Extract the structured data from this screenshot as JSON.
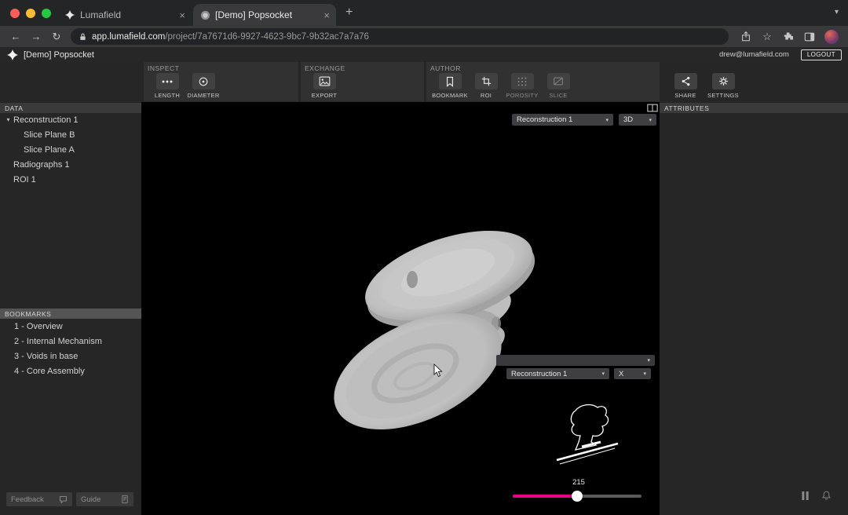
{
  "browser": {
    "tabs": [
      {
        "label": "Lumafield"
      },
      {
        "label": "[Demo] Popsocket"
      }
    ],
    "url_domain": "app.lumafield.com",
    "url_path": "/project/7a7671d6-9927-4623-9bc7-9b32ac7a7a76"
  },
  "icons": {
    "close": "×",
    "new_tab": "+",
    "chevron_down": "▾",
    "back": "←",
    "forward": "→",
    "reload": "↻",
    "star": "☆",
    "kebab": "⋮"
  },
  "app_header": {
    "title": "[Demo] Popsocket",
    "email": "drew@lumafield.com",
    "logout": "LOGOUT"
  },
  "toolbar": {
    "inspect": {
      "label": "INSPECT",
      "length": "LENGTH",
      "diameter": "DIAMETER"
    },
    "exchange": {
      "label": "EXCHANGE",
      "export": "EXPORT"
    },
    "author": {
      "label": "AUTHOR",
      "bookmark": "BOOKMARK",
      "roi": "ROI",
      "porosity": "POROSITY",
      "slice": "SLICE"
    },
    "share": "SHARE",
    "settings": "SETTINGS"
  },
  "data_panel": {
    "header": "DATA",
    "items": [
      {
        "label": "Reconstruction 1",
        "expanded": true
      },
      {
        "label": "Slice Plane B"
      },
      {
        "label": "Slice Plane A"
      },
      {
        "label": "Radiographs 1"
      },
      {
        "label": "ROI 1"
      }
    ]
  },
  "bookmarks_panel": {
    "header": "BOOKMARKS",
    "items": [
      {
        "label": "1 - Overview"
      },
      {
        "label": "2 - Internal Mechanism"
      },
      {
        "label": "3 - Voids in base"
      },
      {
        "label": "4 - Core Assembly"
      }
    ]
  },
  "footer": {
    "feedback": "Feedback",
    "guide": "Guide"
  },
  "viewport": {
    "recon_dropdown": "Reconstruction 1",
    "view_dropdown": "3D",
    "slice_panel": {
      "recon_dropdown": "Reconstruction 1",
      "axis_dropdown": "X",
      "slice_value": "215"
    }
  },
  "attributes_panel": {
    "header": "ATTRIBUTES"
  },
  "colors": {
    "accent": "#e80087",
    "viewport_bg": "#000000"
  }
}
